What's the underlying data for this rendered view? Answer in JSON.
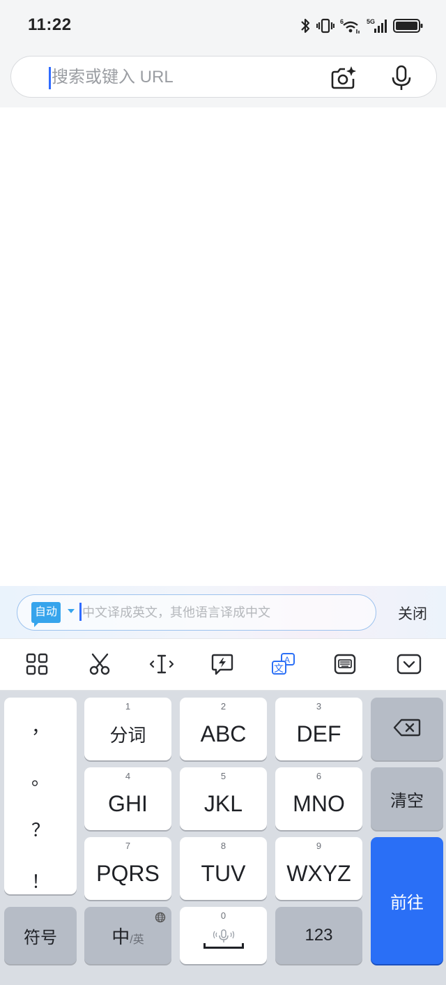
{
  "status_bar": {
    "time": "11:22",
    "network": "5G",
    "icons": [
      "bluetooth-icon",
      "vibrate-icon",
      "wifi-6-icon",
      "5g-signal-icon",
      "battery-icon"
    ]
  },
  "url_bar": {
    "placeholder": "搜索或键入 URL",
    "value": "",
    "icons": [
      "camera-sparkle-icon",
      "microphone-icon"
    ]
  },
  "translate_bar": {
    "mode_badge": "自动",
    "placeholder": "中文译成英文，其他语言译成中文",
    "close_label": "关闭"
  },
  "toolbar": {
    "items": [
      "grid-icon",
      "scissors-icon",
      "cursor-move-icon",
      "quick-reply-icon",
      "translate-icon",
      "keyboard-icon",
      "collapse-keyboard-icon"
    ],
    "active": "translate-icon"
  },
  "keyboard": {
    "punctuation": [
      "，",
      "。",
      "？",
      "！"
    ],
    "keys": [
      {
        "num": "1",
        "label": "分词"
      },
      {
        "num": "2",
        "label": "ABC"
      },
      {
        "num": "3",
        "label": "DEF"
      },
      {
        "num": "4",
        "label": "GHI"
      },
      {
        "num": "5",
        "label": "JKL"
      },
      {
        "num": "6",
        "label": "MNO"
      },
      {
        "num": "7",
        "label": "PQRS"
      },
      {
        "num": "8",
        "label": "TUV"
      },
      {
        "num": "9",
        "label": "WXYZ"
      }
    ],
    "clear_label": "清空",
    "go_label": "前往",
    "symbol_label": "符号",
    "lang_primary": "中",
    "lang_secondary": "/英",
    "zero_num": "0",
    "number_label": "123"
  },
  "colors": {
    "accent": "#2a6ff6",
    "caret": "#2f6bff",
    "badge": "#36a4ec",
    "keyboard_bg": "#d9dde3",
    "gray_key": "#b6bcc6"
  }
}
